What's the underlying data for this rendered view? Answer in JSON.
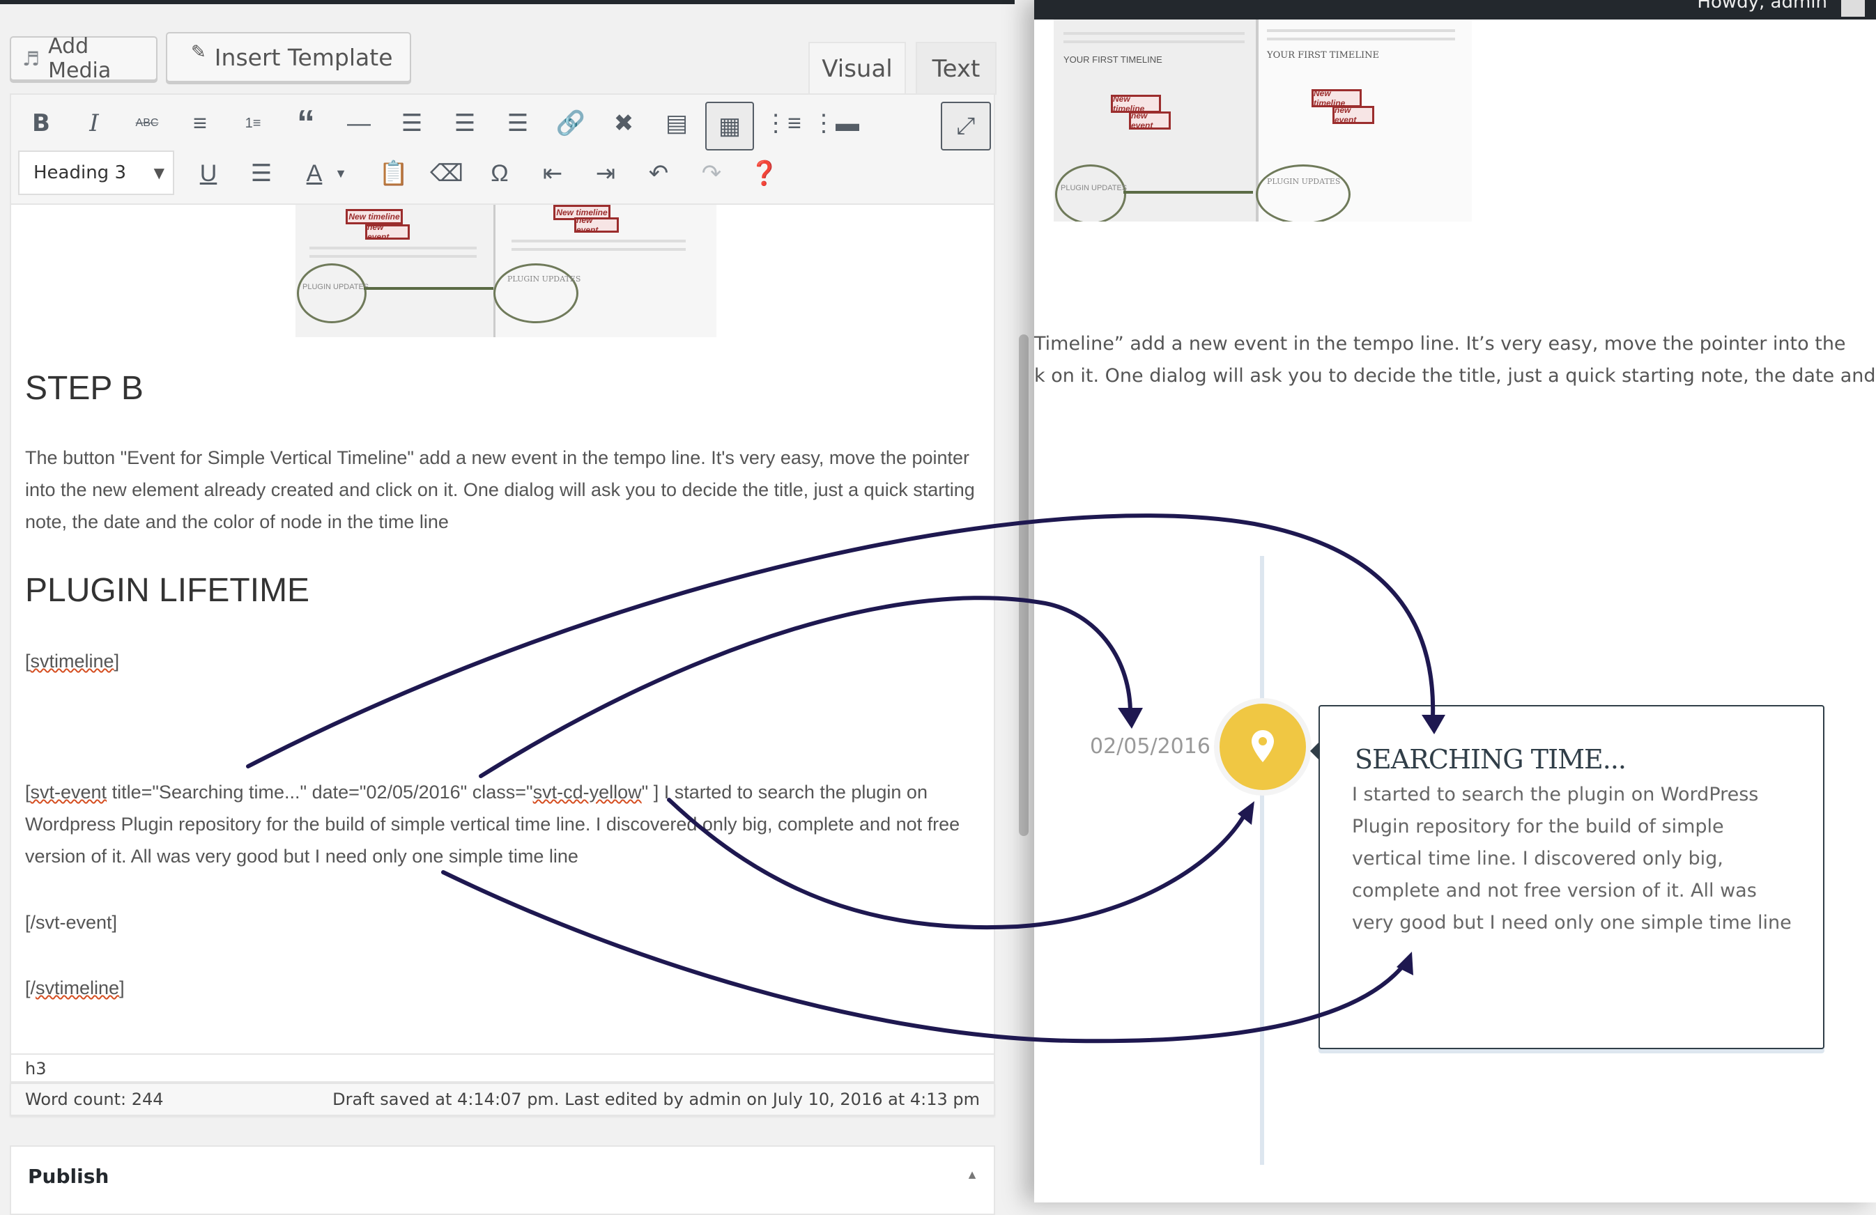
{
  "editor": {
    "add_media_label": "Add Media",
    "insert_template_label": "Insert Template",
    "tabs": [
      {
        "label": "Visual",
        "active": true
      },
      {
        "label": "Text",
        "active": false
      }
    ],
    "toolbar_row1": [
      "bold-icon",
      "italic-icon",
      "strikethrough-icon",
      "bullet-list-icon",
      "numbered-list-icon",
      "blockquote-icon",
      "horizontal-rule-icon",
      "align-left-icon",
      "align-center-icon",
      "align-right-icon",
      "insert-link-icon",
      "remove-link-icon",
      "read-more-icon",
      "toolbar-toggle-icon",
      "new-timeline-icon",
      "new-event-icon"
    ],
    "toolbar_row2": [
      "underline-icon",
      "justify-icon",
      "text-color-icon",
      "text-color-dropdown-icon",
      "paste-as-text-icon",
      "clear-formatting-icon",
      "special-character-icon",
      "outdent-icon",
      "indent-icon",
      "undo-icon",
      "redo-icon",
      "help-icon"
    ],
    "format_select": "Heading 3",
    "fullscreen_label": "Distraction-free writing",
    "content": {
      "step_b_heading": "STEP B",
      "step_b_text": "The button \"Event for Simple Vertical Timeline\" add a new event in the tempo line. It's very easy, move the pointer into the new element already created and click on it. One dialog will ask you to decide the title, just a quick starting note, the date and the color of node in the time line",
      "lifetime_heading": "PLUGIN LIFETIME",
      "open_timeline": "[svtimeline]",
      "event_open_prefix": "[",
      "event_tag": "svt-event",
      "event_attrs_1": " title=\"Searching time...\" date=\"02/05/2016\" class=\"",
      "event_class": "svt-cd-yellow",
      "event_attrs_2": "\" ]  I started to search the plugin on Wordpress Plugin repository for the build of simple vertical time line. I discovered only big, complete and not free version of it. All was very good but I need only one simple time line",
      "close_event": "[/svt-event]",
      "close_timeline_prefix": "[/",
      "close_timeline_tag": "svtimeline",
      "close_timeline_suffix": "]",
      "open_timeline_prefix": "[",
      "open_timeline_tag": "svtimeline",
      "open_timeline_suffix": "]"
    },
    "element_path": "h3",
    "word_count": "Word count: 244",
    "draft_status": "Draft saved at 4:14:07 pm. Last edited by admin on July 10, 2016 at 4:13 pm"
  },
  "publish_box": {
    "title": "Publish"
  },
  "preview": {
    "admin_greeting": "Howdy, admin",
    "text_line_1": "Timeline” add a new event in the tempo line. It’s very easy, move the pointer into the",
    "text_line_2": "k on it. One dialog will ask you to decide the title, just a quick starting note, the date and",
    "thumbnail": {
      "left_heading": "YOUR FIRST TIMELINE",
      "right_heading": "YOUR FIRST TIMELINE",
      "new_timeline": "New timeline",
      "new_event": "new event",
      "plugin_updates_left": "PLUGIN UPDATES",
      "plugin_updates_right": "PLUGIN UPDATES"
    },
    "timeline": {
      "date": "02/05/2016",
      "title": "SEARCHING TIME...",
      "text": " I started to search the plugin on WordPress Plugin repository for the build of simple vertical time line. I discovered only big, complete and not free version of it. All was very good but I need only one simple time line",
      "node_color": "#f0c743",
      "node_icon": "map-pin-icon"
    }
  },
  "colors": {
    "annotation_ink": "#1e1850",
    "admin_bar": "#23282d",
    "node_yellow": "#f0c743"
  }
}
